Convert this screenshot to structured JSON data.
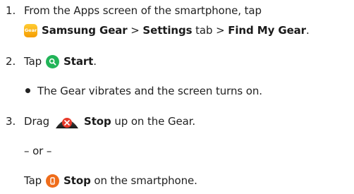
{
  "steps": [
    {
      "number": "1.",
      "line1": "From the Apps screen of the smartphone, tap",
      "icon_label": "Gear",
      "app_name": "Samsung Gear",
      "sep1": " > ",
      "tab_name": "Settings",
      "tab_word": " tab > ",
      "feature_name": "Find My Gear",
      "end": "."
    },
    {
      "number": "2.",
      "prefix": "Tap",
      "button": "Start",
      "end": ".",
      "bullet": "The Gear vibrates and the screen turns on."
    },
    {
      "number": "3.",
      "prefix": "Drag",
      "button": "Stop",
      "suffix": " up on the Gear.",
      "or_text": "– or –",
      "alt_prefix": "Tap",
      "alt_button": "Stop",
      "alt_suffix": " on the smartphone."
    }
  ],
  "icons": {
    "gear_app": "samsung-gear-app-icon",
    "start": "search-icon",
    "stop_gear": "close-icon",
    "stop_phone": "phone-icon"
  },
  "colors": {
    "gear_app": "#f7a800",
    "start": "#21b458",
    "stop_gear": "#e8392a",
    "stop_phone": "#ef6c1a"
  }
}
